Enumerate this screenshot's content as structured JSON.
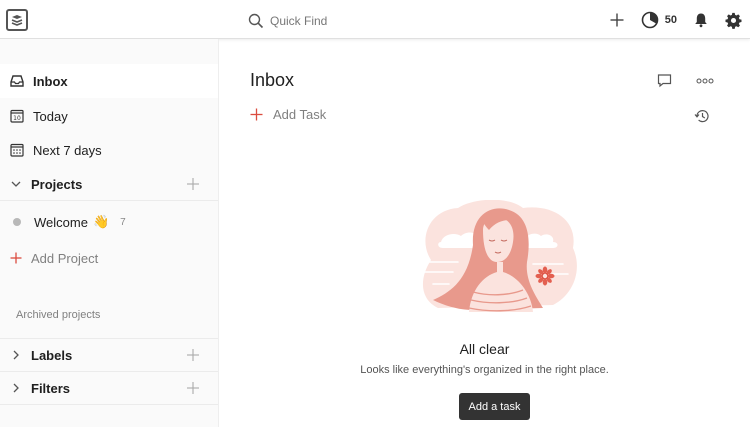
{
  "topbar": {
    "search_placeholder": "Quick Find",
    "karma_count": "50",
    "icons": [
      "app-logo-icon",
      "search-icon",
      "add-icon",
      "karma-icon",
      "bell-icon",
      "gear-icon"
    ]
  },
  "sidebar": {
    "items": [
      {
        "label": "Inbox",
        "icon": "inbox-icon",
        "active": true
      },
      {
        "label": "Today",
        "icon": "calendar-today-icon",
        "day": "10"
      },
      {
        "label": "Next 7 days",
        "icon": "calendar-week-icon"
      }
    ],
    "projects": {
      "label": "Projects",
      "items": [
        {
          "label": "Welcome",
          "emoji": "👋",
          "count": "7",
          "dot_color": "#b8b8b8"
        }
      ],
      "add_label": "Add Project",
      "archived_label": "Archived projects"
    },
    "labels_label": "Labels",
    "filters_label": "Filters"
  },
  "main": {
    "title": "Inbox",
    "add_task_label": "Add Task",
    "empty": {
      "title": "All clear",
      "subtitle": "Looks like everything's organized in the right place.",
      "button": "Add a task"
    }
  },
  "colors": {
    "accent": "#db4c3f",
    "illustration_pink": "#f5c6bd",
    "illustration_salmon": "#e8998c",
    "button_dark": "#333333"
  }
}
